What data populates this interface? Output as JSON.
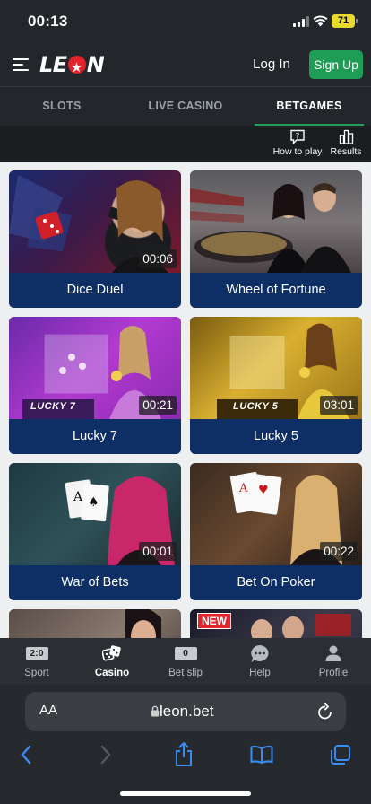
{
  "status_bar": {
    "time": "00:13",
    "battery": "71"
  },
  "header": {
    "logo": "LEON",
    "login_label": "Log In",
    "signup_label": "Sign Up"
  },
  "tabs": [
    {
      "label": "SLOTS"
    },
    {
      "label": "LIVE CASINO"
    },
    {
      "label": "BETGAMES"
    }
  ],
  "toolbar": {
    "how_to_play": "How to play",
    "results": "Results"
  },
  "games": [
    {
      "title": "Dice Duel",
      "timer": "00:06"
    },
    {
      "title": "Wheel of Fortune",
      "timer": ""
    },
    {
      "title": "Lucky 7",
      "timer": "00:21",
      "badge": "LUCKY 7"
    },
    {
      "title": "Lucky 5",
      "timer": "03:01",
      "badge": "LUCKY 5"
    },
    {
      "title": "War of Bets",
      "timer": "00:01"
    },
    {
      "title": "Bet On Poker",
      "timer": "00:22"
    },
    {
      "title": "",
      "timer": ""
    },
    {
      "title": "",
      "timer": "",
      "badge": "NEW"
    }
  ],
  "bottom_nav": [
    {
      "label": "Sport",
      "badge": "2:0"
    },
    {
      "label": "Casino"
    },
    {
      "label": "Bet slip",
      "badge": "0"
    },
    {
      "label": "Help"
    },
    {
      "label": "Profile"
    }
  ],
  "browser": {
    "aa_label": "AA",
    "url": "leon.bet"
  },
  "colors": {
    "accent_green": "#1f9c56",
    "card_blue": "#0e2f65",
    "brand_red": "#e3232b"
  }
}
